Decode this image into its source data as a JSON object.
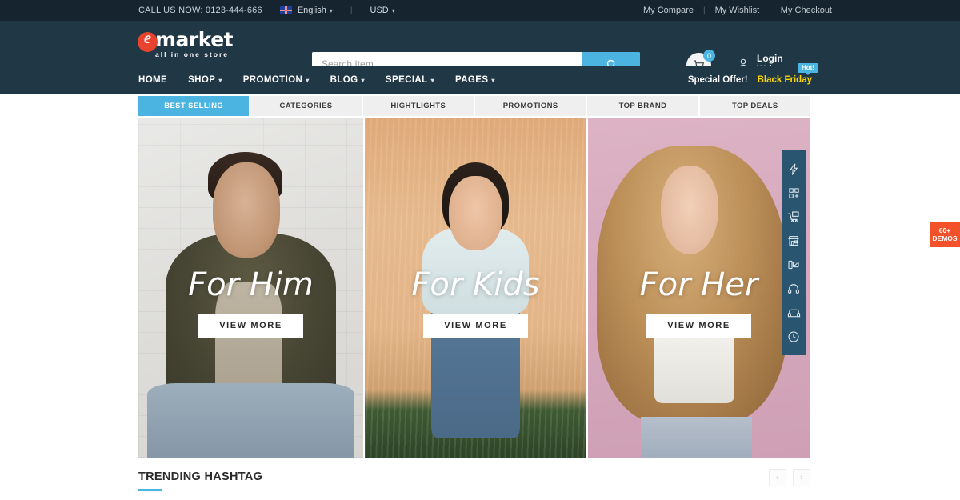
{
  "topbar": {
    "call_us": "CALL US NOW: 0123-444-666",
    "language": "English",
    "currency": "USD",
    "links": [
      "My Compare",
      "My Wishlist",
      "My Checkout"
    ]
  },
  "header": {
    "logo_main": "market",
    "logo_mark": "e",
    "logo_sub": "all in one store",
    "search_placeholder": "Search Item...",
    "search_value": "",
    "cart_count": "0",
    "login_label": "Login",
    "welcome_label": "Welcome Guest"
  },
  "nav": {
    "items": [
      {
        "label": "HOME",
        "has_caret": false
      },
      {
        "label": "SHOP",
        "has_caret": true
      },
      {
        "label": "PROMOTION",
        "has_caret": true
      },
      {
        "label": "BLOG",
        "has_caret": true
      },
      {
        "label": "SPECIAL",
        "has_caret": true
      },
      {
        "label": "PAGES",
        "has_caret": true
      }
    ],
    "special_offer": "Special Offer!",
    "black_friday": "Black Friday",
    "hot_badge": "Hot!"
  },
  "tabs": [
    {
      "label": "BEST SELLING",
      "active": true
    },
    {
      "label": "CATEGORIES",
      "active": false
    },
    {
      "label": "HIGHTLIGHTS",
      "active": false
    },
    {
      "label": "PROMOTIONS",
      "active": false
    },
    {
      "label": "TOP BRAND",
      "active": false
    },
    {
      "label": "TOP DEALS",
      "active": false
    }
  ],
  "banners": [
    {
      "title": "For Him",
      "button": "VIEW MORE"
    },
    {
      "title": "For Kids",
      "button": "VIEW MORE"
    },
    {
      "title": "For Her",
      "button": "VIEW MORE"
    }
  ],
  "icon_rail": [
    "flash-icon",
    "grid-add-icon",
    "cart-monitor-icon",
    "store-icon",
    "device-edit-icon",
    "headphones-icon",
    "sofa-icon",
    "clock-icon"
  ],
  "demos_tab": {
    "line1": "60+",
    "line2": "DEMOS"
  },
  "trending": {
    "title": "TRENDING HASHTAG",
    "prev": "‹",
    "next": "›"
  },
  "colors": {
    "topbar_bg": "#16242f",
    "header_bg": "#203746",
    "accent_blue": "#4cb4e0",
    "logo_red": "#e8432e",
    "yellow": "#ffd600",
    "orange": "#f2512a",
    "rail_bg": "#2a5570"
  }
}
